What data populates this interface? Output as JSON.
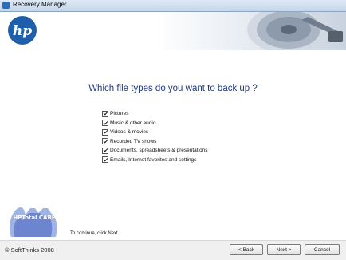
{
  "window": {
    "title": "Recovery Manager"
  },
  "header": {
    "logo_text": "hp"
  },
  "main": {
    "question": "Which file types do you want to back up ?",
    "options": [
      {
        "label": "Pictures",
        "checked": true
      },
      {
        "label": "Music & other audio",
        "checked": true
      },
      {
        "label": "Videos & movies",
        "checked": true
      },
      {
        "label": "Recorded TV shows",
        "checked": true
      },
      {
        "label": "Documents, spreadsheets & presentations",
        "checked": true
      },
      {
        "label": "Emails, Internet favorites and settings",
        "checked": true
      }
    ],
    "hint": "To continue, click Next.",
    "care_logo_text": "HPTotal CARE"
  },
  "footer": {
    "copyright": "© SoftThinks 2008",
    "back_label": "< Back",
    "next_label": "Next >",
    "cancel_label": "Cancel"
  },
  "colors": {
    "brand": "#1f5fa9",
    "question": "#1f3a8a"
  }
}
